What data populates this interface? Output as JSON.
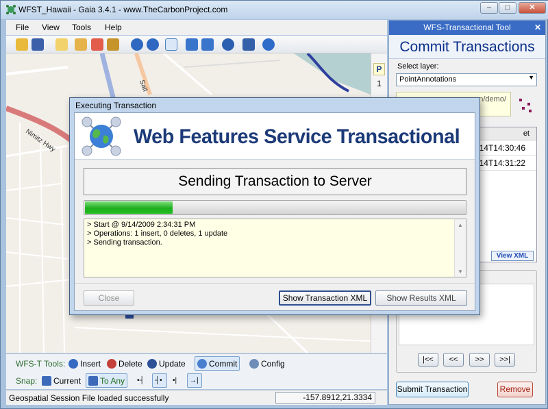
{
  "window": {
    "title": "WFST_Hawaii - Gaia 3.4.1 - www.TheCarbonProject.com"
  },
  "menu": [
    "File",
    "View",
    "Tools",
    "Help"
  ],
  "map_side": {
    "tab_p": "P",
    "tab_1": "1"
  },
  "map_labels": {
    "street1": "Nimitz Hwy",
    "street2": "Salt"
  },
  "wfst_toolbar": {
    "label": "WFS-T Tools:",
    "insert": "Insert",
    "delete": "Delete",
    "update": "Update",
    "commit": "Commit",
    "config": "Config"
  },
  "snap_toolbar": {
    "label": "Snap:",
    "current": "Current",
    "to_any": "To Any"
  },
  "status": {
    "message": "Geospatial Session File loaded successfully",
    "coords": "-157.8912,21.3334"
  },
  "panel": {
    "title": "WFS-Transactional Tool",
    "heading": "Commit Transactions",
    "select_label": "Select layer:",
    "selected_layer": "PointAnnotations",
    "url_fragment": "n/demo/",
    "list_header": "et",
    "rows": [
      "-14T14:30:46",
      "-14T14:31:22"
    ],
    "view_xml": "View XML",
    "result_title": "e",
    "nav": [
      "|<<",
      "<<",
      ">>",
      ">>|"
    ],
    "submit": "Submit Transaction",
    "remove": "Remove"
  },
  "dialog": {
    "title": "Executing Transaction",
    "banner": "Web Features Service Transactional",
    "status": "Sending Transaction to Server",
    "progress": 0.23,
    "log": [
      "> Start @ 9/14/2009 2:34:31 PM",
      "> Operations: 1 insert, 0 deletes, 1 update",
      "> Sending transaction."
    ],
    "close": "Close",
    "show_txn_xml": "Show Transaction XML",
    "show_results_xml": "Show Results XML"
  },
  "colors": {
    "accent": "#3a6cc5",
    "progress": "#1eae1e",
    "heading": "#0b2f8a"
  }
}
